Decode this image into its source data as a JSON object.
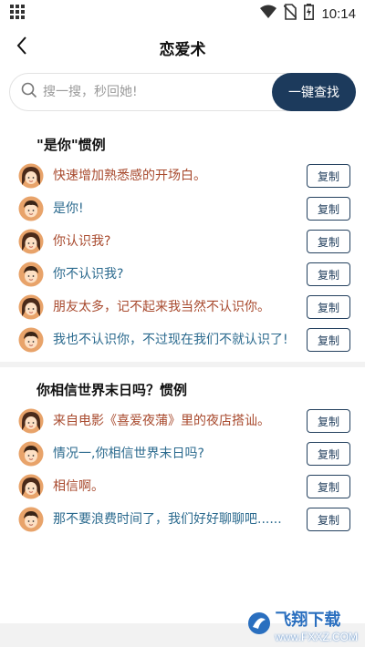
{
  "status_bar": {
    "time": "10:14",
    "icons": [
      "grid-icon",
      "wifi-icon",
      "no-sim-icon",
      "battery-charging-icon"
    ]
  },
  "header": {
    "title": "恋爱术",
    "back_icon": "chevron-left-icon"
  },
  "search": {
    "placeholder": "搜一搜，秒回她!",
    "button_label": "一键查找",
    "icon": "search-icon"
  },
  "colors": {
    "accent": "#1c3a5c",
    "her_text": "#a84a2e",
    "him_text": "#2b6a8e"
  },
  "copy_label": "复制",
  "sections": [
    {
      "title": "\"是你\"惯例",
      "items": [
        {
          "speaker": "her",
          "text": "快速增加熟悉感的开场白。"
        },
        {
          "speaker": "him",
          "text": "是你!"
        },
        {
          "speaker": "her",
          "text": "你认识我?"
        },
        {
          "speaker": "him",
          "text": "你不认识我?"
        },
        {
          "speaker": "her",
          "text": "朋友太多，记不起来我当然不认识你。"
        },
        {
          "speaker": "him",
          "text": "我也不认识你，不过现在我们不就认识了!"
        }
      ]
    },
    {
      "title": "你相信世界末日吗？惯例",
      "items": [
        {
          "speaker": "her",
          "text": "来自电影《喜爱夜蒲》里的夜店搭讪。"
        },
        {
          "speaker": "him",
          "text": "情况一,你相信世界末日吗?"
        },
        {
          "speaker": "her",
          "text": "相信啊。"
        },
        {
          "speaker": "him",
          "text": "那不要浪费时间了，我们好好聊聊吧......"
        }
      ]
    }
  ],
  "watermark": {
    "brand": "飞翔下载",
    "url": "www.FXXZ.COM"
  }
}
